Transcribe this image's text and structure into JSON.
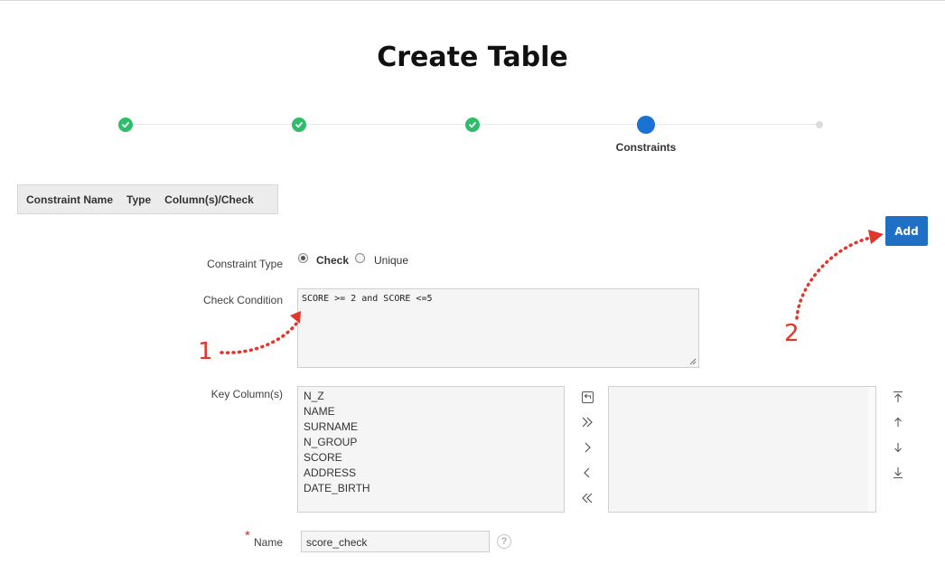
{
  "page": {
    "title": "Create Table"
  },
  "wizard": {
    "current_step_label": "Constraints"
  },
  "constraints_table": {
    "columns": [
      "Constraint Name",
      "Type",
      "Column(s)/Check"
    ]
  },
  "form": {
    "add_label": "Add",
    "constraint_type": {
      "label": "Constraint Type",
      "options": [
        "Check",
        "Unique"
      ],
      "selected": "Check"
    },
    "check_condition": {
      "label": "Check Condition",
      "value": "SCORE >= 2 and SCORE <=5"
    },
    "key_columns": {
      "label": "Key Column(s)",
      "available": [
        "N_Z",
        "NAME",
        "SURNAME",
        "N_GROUP",
        "SCORE",
        "ADDRESS",
        "DATE_BIRTH"
      ],
      "selected": []
    },
    "name": {
      "label": "Name",
      "required_marker": "*",
      "value": "score_check",
      "help_glyph": "?"
    }
  },
  "annotations": {
    "marker_1": "1",
    "marker_2": "2"
  },
  "colors": {
    "step_done": "#2ebd6b",
    "step_current": "#1a73d2",
    "add_button": "#1f6fc5",
    "annotation": "#e0362c"
  }
}
